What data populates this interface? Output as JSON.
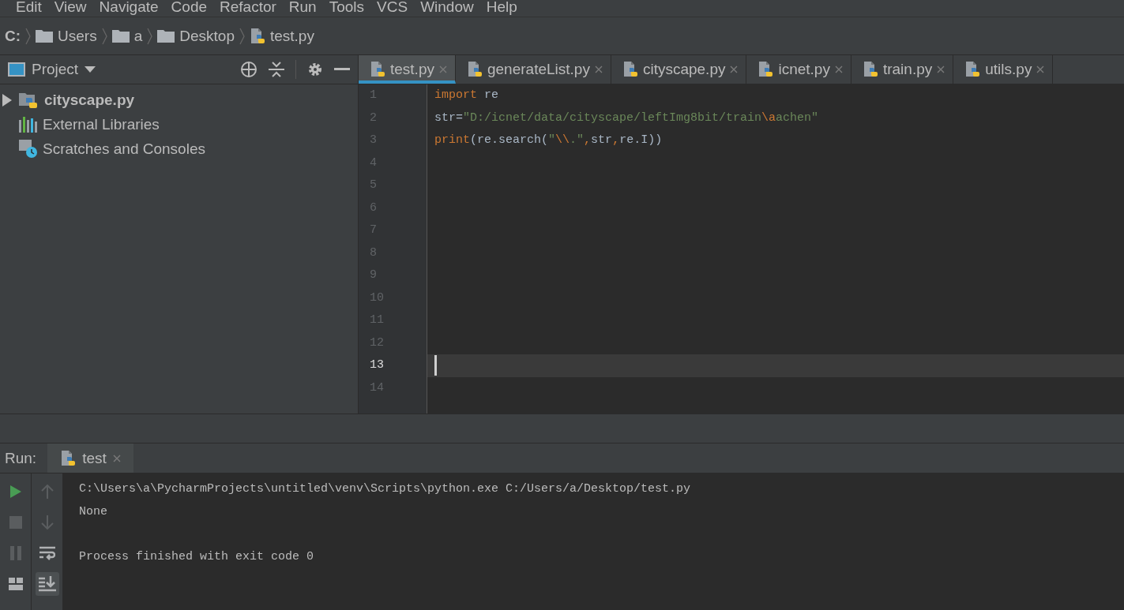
{
  "menu": [
    "Edit",
    "View",
    "Navigate",
    "Code",
    "Refactor",
    "Run",
    "Tools",
    "VCS",
    "Window",
    "Help"
  ],
  "breadcrumbs": [
    {
      "label": "C:",
      "kind": "drive"
    },
    {
      "label": "Users",
      "kind": "folder"
    },
    {
      "label": "a",
      "kind": "folder"
    },
    {
      "label": "Desktop",
      "kind": "folder"
    },
    {
      "label": "test.py",
      "kind": "python"
    }
  ],
  "project_panel": {
    "title": "Project",
    "tree": [
      {
        "label": "cityscape.py",
        "kind": "python-folder",
        "expanded": false
      },
      {
        "label": "External Libraries",
        "kind": "libraries"
      },
      {
        "label": "Scratches and Consoles",
        "kind": "scratches"
      }
    ]
  },
  "tabs": [
    {
      "label": "test.py",
      "selected": true
    },
    {
      "label": "generateList.py",
      "selected": false
    },
    {
      "label": "cityscape.py",
      "selected": false
    },
    {
      "label": "icnet.py",
      "selected": false
    },
    {
      "label": "train.py",
      "selected": false
    },
    {
      "label": "utils.py",
      "selected": false
    }
  ],
  "editor": {
    "lines": [
      {
        "number": "1",
        "current": false,
        "tokens": [
          {
            "text": "import",
            "kind": "keyword"
          },
          {
            "text": " re",
            "kind": "plain"
          }
        ]
      },
      {
        "number": "2",
        "current": false,
        "tokens": [
          {
            "text": "str=",
            "kind": "plain"
          },
          {
            "text": "\"D:/icnet/data/cityscape/leftImg8bit/train",
            "kind": "string"
          },
          {
            "text": "\\a",
            "kind": "escape"
          },
          {
            "text": "achen\"",
            "kind": "string"
          }
        ]
      },
      {
        "number": "3",
        "current": false,
        "tokens": [
          {
            "text": "print",
            "kind": "keyword"
          },
          {
            "text": "(re.search(",
            "kind": "plain"
          },
          {
            "text": "\"",
            "kind": "string"
          },
          {
            "text": "\\\\",
            "kind": "escape"
          },
          {
            "text": ".\"",
            "kind": "string"
          },
          {
            "text": ",",
            "kind": "keyword"
          },
          {
            "text": "str",
            "kind": "plain"
          },
          {
            "text": ",",
            "kind": "keyword"
          },
          {
            "text": "re.I))",
            "kind": "plain"
          }
        ]
      },
      {
        "number": "4",
        "current": false
      },
      {
        "number": "5",
        "current": false
      },
      {
        "number": "6",
        "current": false
      },
      {
        "number": "7",
        "current": false
      },
      {
        "number": "8",
        "current": false
      },
      {
        "number": "9",
        "current": false
      },
      {
        "number": "10",
        "current": false
      },
      {
        "number": "11",
        "current": false
      },
      {
        "number": "12",
        "current": false
      },
      {
        "number": "13",
        "current": true
      },
      {
        "number": "14",
        "current": false
      }
    ]
  },
  "run_panel": {
    "label": "Run:",
    "tab": "test",
    "tools_left": [
      {
        "kind": "run",
        "disabled": false
      },
      {
        "kind": "stop",
        "disabled": true
      },
      {
        "kind": "pause",
        "disabled": true
      },
      {
        "kind": "layout",
        "disabled": false
      }
    ],
    "tools_right": [
      {
        "kind": "up",
        "disabled": true,
        "selected": false
      },
      {
        "kind": "down",
        "disabled": true,
        "selected": false
      },
      {
        "kind": "wrap",
        "disabled": false,
        "selected": false
      },
      {
        "kind": "scroll-end",
        "disabled": false,
        "selected": true
      }
    ],
    "output": [
      {
        "text": "C:\\Users\\a\\PycharmProjects\\untitled\\venv\\Scripts\\python.exe C:/Users/a/Desktop/test.py",
        "blank_before": false
      },
      {
        "text": "None",
        "blank_before": false
      },
      {
        "text": "Process finished with exit code 0",
        "blank_before": true
      }
    ]
  }
}
